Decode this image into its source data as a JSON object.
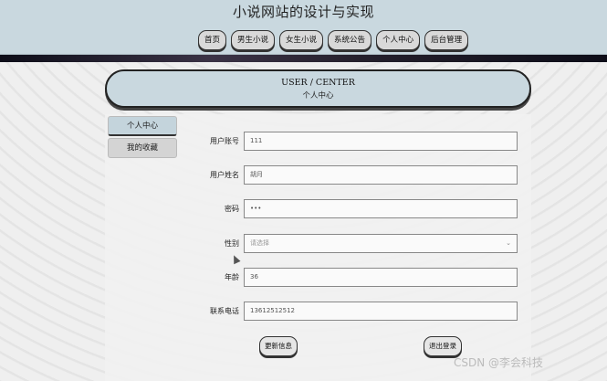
{
  "header": {
    "site_title": "小说网站的设计与实现",
    "nav": [
      "首页",
      "男生小说",
      "女生小说",
      "系统公告",
      "个人中心",
      "后台管理"
    ]
  },
  "banner": {
    "title": "USER / CENTER",
    "subtitle": "个人中心"
  },
  "sidebar": {
    "items": [
      {
        "label": "个人中心",
        "active": true
      },
      {
        "label": "我的收藏",
        "active": false
      }
    ]
  },
  "form": {
    "account": {
      "label": "用户账号",
      "value": "111"
    },
    "name": {
      "label": "用户姓名",
      "value": "胡月"
    },
    "password": {
      "label": "密码",
      "value": "•••"
    },
    "gender": {
      "label": "性别",
      "placeholder": "请选择"
    },
    "age": {
      "label": "年龄",
      "value": "36"
    },
    "phone": {
      "label": "联系电话",
      "value": "13612512512"
    }
  },
  "actions": {
    "update_label": "更新信息",
    "logout_label": "退出登录"
  },
  "watermark": "CSDN @李会科技",
  "colors": {
    "header_bg": "#c9d8df",
    "active_tab": "#c4d4dc",
    "page_bg": "#efefef"
  }
}
